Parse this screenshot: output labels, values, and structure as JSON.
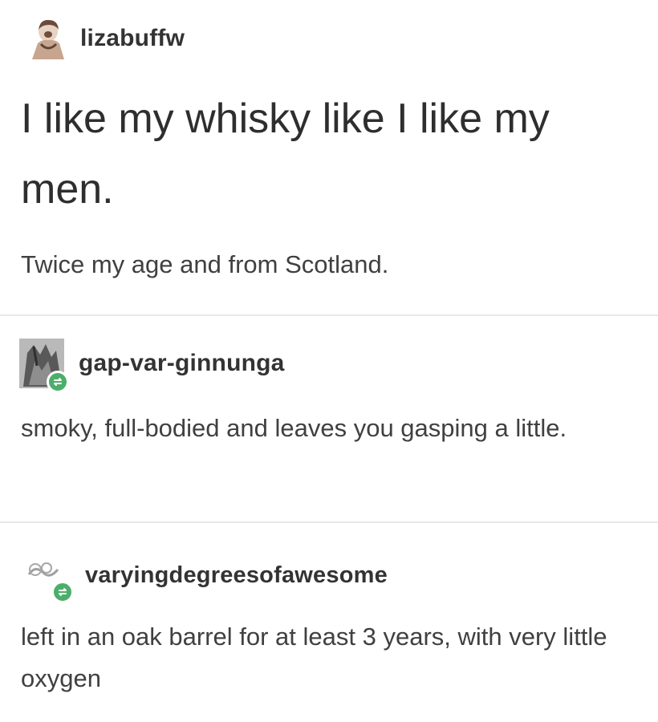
{
  "post": {
    "original": {
      "username": "lizabuffw",
      "title": "I like my whisky like I like my men.",
      "body": "Twice my age and from Scotland."
    },
    "replies": [
      {
        "username": "gap-var-ginnunga",
        "body": "smoky, full-bodied and leaves you gasping a little.",
        "icon": "reblog-icon"
      },
      {
        "username": "varyingdegreesofawesome",
        "body": "left in an oak barrel for at least 3 years, with very little oxygen",
        "icon": "reblog-icon"
      }
    ]
  },
  "colors": {
    "reblog_badge": "#4cae6a",
    "divider": "#e8e8e8",
    "text": "#3c3c3c"
  }
}
